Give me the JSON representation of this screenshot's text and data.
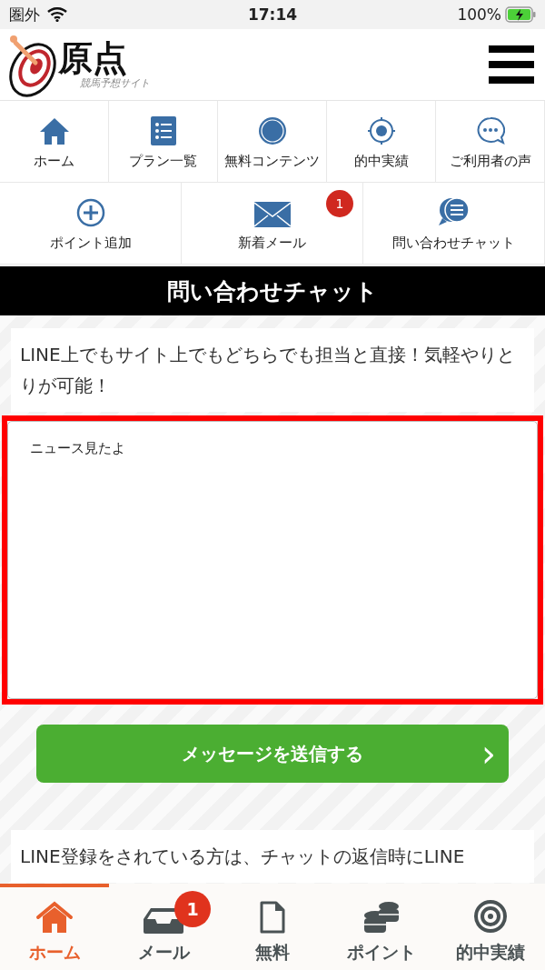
{
  "status_bar": {
    "carrier": "圏外",
    "time": "17:14",
    "battery": "100%"
  },
  "header": {
    "logo_title": "原点",
    "logo_subtitle": "競馬予想サイト"
  },
  "nav_rows": [
    [
      {
        "kind": "home",
        "label": "ホーム"
      },
      {
        "kind": "list",
        "label": "プラン一覧"
      },
      {
        "kind": "seal",
        "label": "無料コンテンツ"
      },
      {
        "kind": "target",
        "label": "的中実績"
      },
      {
        "kind": "chat-dots",
        "label": "ご利用者の声"
      }
    ],
    [
      {
        "kind": "plus",
        "label": "ポイント追加"
      },
      {
        "kind": "mail",
        "label": "新着メール",
        "badge": "1"
      },
      {
        "kind": "chat-lines",
        "label": "問い合わせチャット"
      }
    ]
  ],
  "page_title": "問い合わせチャット",
  "info_text": "LINE上でもサイト上でもどちらでも担当と直接！気軽やりとりが可能！",
  "message_field": {
    "value": "ニュース見たよ"
  },
  "send_button": {
    "label": "メッセージを送信する",
    "arrow": "›"
  },
  "notice_text": "LINE登録をされている方は、チャットの返信時にLINE",
  "tab_bar": [
    {
      "kind": "home",
      "label": "ホーム",
      "selected": true
    },
    {
      "kind": "inbox",
      "label": "メール",
      "selected": false,
      "badge": "1"
    },
    {
      "kind": "file",
      "label": "無料",
      "selected": false
    },
    {
      "kind": "coins",
      "label": "ポイント",
      "selected": false
    },
    {
      "kind": "target",
      "label": "的中実績",
      "selected": false
    }
  ]
}
